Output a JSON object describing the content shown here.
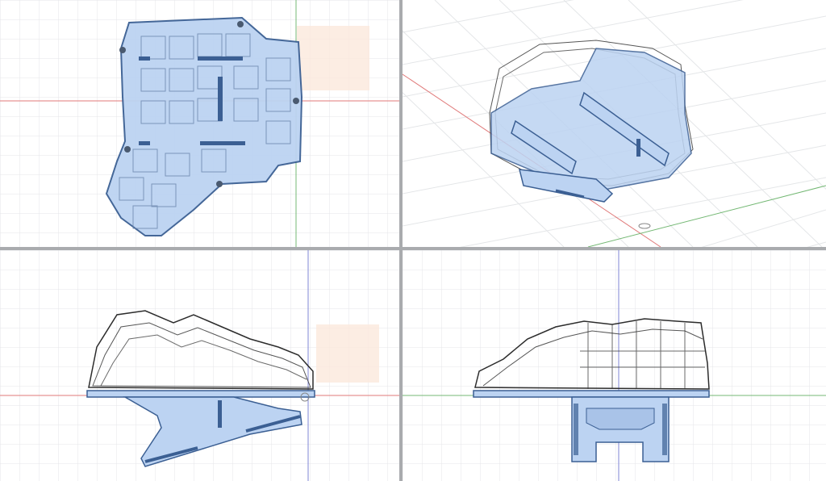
{
  "app": {
    "viewports": [
      {
        "id": "top",
        "label": ""
      },
      {
        "id": "perspective",
        "label": ""
      },
      {
        "id": "front",
        "label": ""
      },
      {
        "id": "right",
        "label": ""
      }
    ]
  },
  "colors": {
    "background_gap": "#a9abae",
    "viewport_bg": "#ffffff",
    "grid_minor": "#e4e6e8",
    "grid_major": "#cfd2d6",
    "axis_x": "#e07a7a",
    "axis_y": "#74b874",
    "axis_z": "#7f86d6",
    "model_fill": "#bcd3f2",
    "model_stroke": "#3b5f93",
    "wire": "#2c2c2c",
    "origin_plane": "#fbe9dc"
  }
}
